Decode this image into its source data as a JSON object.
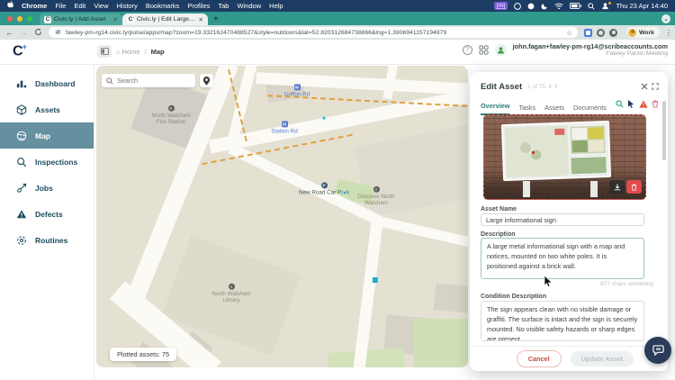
{
  "colors": {
    "menubar_bg": "#1d3c63",
    "tabstrip_bg": "#30988d",
    "accent_teal": "#2e7d72",
    "nav_selected_bg": "#64909f",
    "danger_red": "#e25555",
    "asset_dot_teal": "#1fb0bf"
  },
  "icons": {
    "back": "←",
    "forward": "→",
    "star": "☆",
    "overflow": "⋮",
    "home": "⌂",
    "plus": "+",
    "caret_down": "⌄",
    "close": "✕",
    "prev": "‹",
    "next": "›",
    "question": "?"
  },
  "menubar": {
    "items": [
      "Chrome",
      "File",
      "Edit",
      "View",
      "History",
      "Bookmarks",
      "Profiles",
      "Tab",
      "Window",
      "Help"
    ],
    "clock": "Thu 23 Apr 14:40"
  },
  "browser": {
    "tabs": [
      {
        "title": "Civic.ly | Add Asset"
      },
      {
        "title": "Civic.ly | Edit Large informati..."
      }
    ],
    "favicon_letter": "C",
    "url": "fawley-pm-rg14.civic.ly/pulse/apps/map?zoom=19.332162470488527&style=outdoors&lat=52.820312684738866&lng=1.3906941157194979",
    "profile_label": "Work"
  },
  "app_header": {
    "logo_text": "C",
    "logo_plus": "+",
    "breadcrumb_home": "Home",
    "breadcrumb_sep": "/",
    "breadcrumb_current": "Map",
    "user_email": "john.fagan+fawley-pm-rg14@scribeaccounts.com",
    "organisation": "Fawley Parish Meeting"
  },
  "sidebar": {
    "items": [
      {
        "label": "Dashboard"
      },
      {
        "label": "Assets"
      },
      {
        "label": "Map"
      },
      {
        "label": "Inspections"
      },
      {
        "label": "Jobs"
      },
      {
        "label": "Defects"
      },
      {
        "label": "Routines"
      }
    ]
  },
  "map": {
    "search_placeholder": "Search",
    "plotted_badge": "Plotted assets: 75",
    "pois": [
      {
        "label": "North Walsham Fire Station"
      },
      {
        "label": "Griffon Rd"
      },
      {
        "label": "Station Rd"
      },
      {
        "label": "New Road Car Park"
      },
      {
        "label": "Discover North Walsham"
      },
      {
        "label": "North Walsham Library"
      }
    ],
    "poi_glyphs": {
      "fire": "+",
      "parking": "P",
      "info": "i",
      "library": "≡",
      "transit": "M"
    }
  },
  "panel": {
    "title": "Edit Asset",
    "pager": "1 of 75",
    "tabs": [
      {
        "label": "Overview"
      },
      {
        "label": "Tasks"
      },
      {
        "label": "Assets"
      },
      {
        "label": "Documents"
      }
    ],
    "fields": {
      "asset_name_label": "Asset Name",
      "asset_name_value": "Large informational sign",
      "description_label": "Description",
      "description_value": "A large metal informational sign with a map and notices, mounted on two white poles. It is positioned against a brick wall.",
      "chars_remaining": "877 chars remaining",
      "condition_label": "Condition Description",
      "condition_value": "The sign appears clean with no visible damage or graffiti. The surface is intact and the sign is securely mounted. No visible safety hazards or sharp edges are present."
    },
    "buttons": {
      "cancel": "Cancel",
      "update": "Update Asset"
    }
  }
}
